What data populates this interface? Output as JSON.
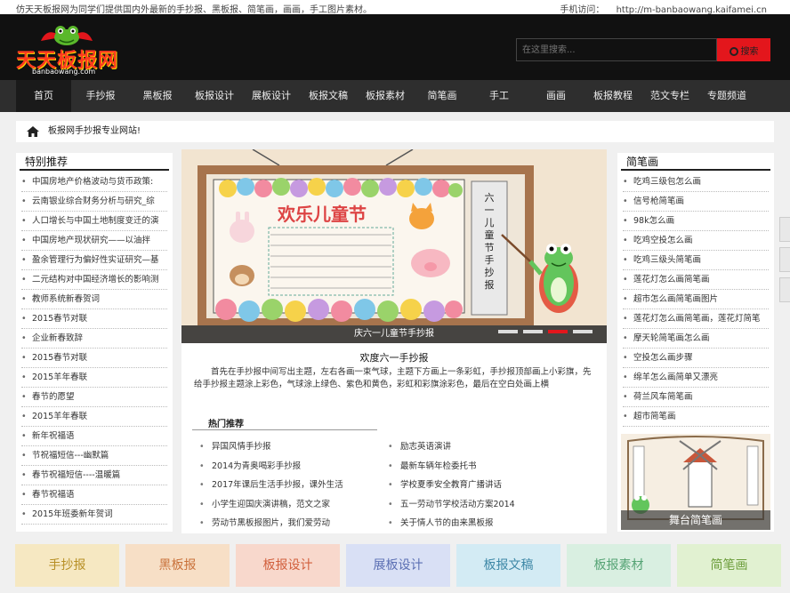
{
  "topbar": {
    "intro": "仿天天板报网为同学们提供国内外最新的手抄报、黑板报、简笔画，画画，手工图片素材。",
    "mobile_label": "手机访问：",
    "mobile_url": "http://m-banbaowang.kaifamei.cn"
  },
  "logo": {
    "brand": "天天板报网",
    "url": "banbaowang.com"
  },
  "search": {
    "placeholder": "在这里搜索...",
    "button": "搜索"
  },
  "nav": [
    "首页",
    "手抄报",
    "黑板报",
    "板报设计",
    "展板设计",
    "板报文稿",
    "板报素材",
    "简笔画",
    "手工",
    "画画",
    "板报教程",
    "范文专栏",
    "专题频道"
  ],
  "breadcrumb": "板报网手抄报专业网站!",
  "featured": {
    "title": "特别推荐",
    "items": [
      "中国房地产价格波动与货币政策:",
      "云南银业综合财务分析与研究_综",
      "人口增长与中国土地制度变迁的演",
      "中国房地产现状研究——以油拌",
      "盈余管理行为偏好性实证研究—基",
      "二元结构对中国经济增长的影响测",
      "教师系统新春贺词",
      "2015春节对联",
      "企业新春致辞",
      "2015春节对联",
      "2015羊年春联",
      "春节的愿望",
      "2015羊年春联",
      "新年祝福语",
      "节祝福短信---幽默篇",
      "春节祝福短信----温暖篇",
      "春节祝福语",
      "2015年班委新年贺词"
    ]
  },
  "slide": {
    "caption": "庆六一儿童节手抄报",
    "board_text": "欢乐儿童节",
    "scroll_text": "六一儿童节手抄报"
  },
  "intro": {
    "title": "欢度六一手抄报",
    "text": "首先在手抄报中间写出主题，左右各画一束气球，主题下方画上一条彩虹，手抄报顶部画上小彩旗，先给手抄报主题涂上彩色，气球涂上绿色、紫色和黄色，彩虹和彩旗涂彩色，最后在空白处画上横"
  },
  "hot": {
    "title": "热门推荐",
    "left": [
      "异国风情手抄报",
      "2014为青奥喝彩手抄报",
      "2017年课后生活手抄报，课外生活",
      "小学生迎国庆演讲稿，范文之家",
      "劳动节黑板报图片，我们爱劳动"
    ],
    "right": [
      "励志英语演讲",
      "最新车辆年检委托书",
      "学校夏季安全教育广播讲话",
      "五一劳动节学校活动方案2014",
      "关于情人节的由来黑板报"
    ]
  },
  "jianbihua": {
    "title": "简笔画",
    "items": [
      "吃鸡三级包怎么画",
      "信号枪简笔画",
      "98k怎么画",
      "吃鸡空投怎么画",
      "吃鸡三级头简笔画",
      "莲花灯怎么画简笔画",
      "超市怎么画简笔画图片",
      "莲花灯怎么画简笔画，莲花灯简笔",
      "摩天轮简笔画怎么画",
      "空投怎么画步骤",
      "绵羊怎么画简单又漂亮",
      "荷兰风车简笔画",
      "超市简笔画"
    ],
    "thumb_caption": "舞台简笔画"
  },
  "tiles": [
    {
      "label": "手抄报",
      "bg": "#f6e8c2",
      "fg": "#b78f25"
    },
    {
      "label": "黑板报",
      "bg": "#f7dfc6",
      "fg": "#c9713a"
    },
    {
      "label": "板报设计",
      "bg": "#f8d8cc",
      "fg": "#d15f3c"
    },
    {
      "label": "展板设计",
      "bg": "#d9e0f5",
      "fg": "#5b6fb3"
    },
    {
      "label": "板报文稿",
      "bg": "#d3ebf4",
      "fg": "#3d87a6"
    },
    {
      "label": "板报素材",
      "bg": "#d9efe1",
      "fg": "#55a374"
    },
    {
      "label": "简笔画",
      "bg": "#e1f1d1",
      "fg": "#6c9d3b"
    }
  ]
}
